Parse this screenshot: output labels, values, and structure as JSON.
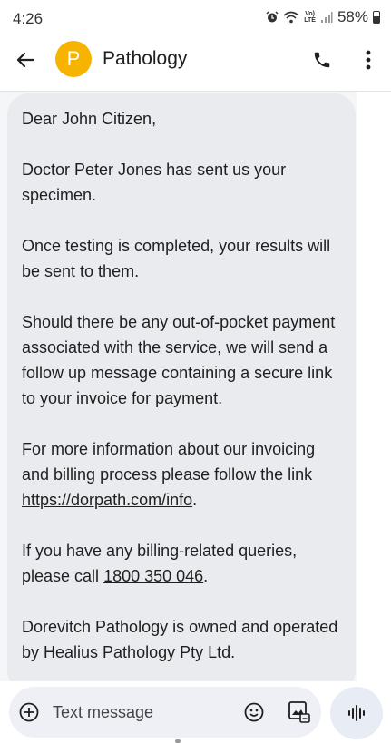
{
  "status_bar": {
    "time": "4:26",
    "volte_line1": "Vo)",
    "volte_line2": "LTE",
    "battery_percent": "58%",
    "icons": [
      "alarm-icon",
      "wifi-icon",
      "volte-icon",
      "signal-icon",
      "battery-icon"
    ]
  },
  "app_bar": {
    "avatar_letter": "P",
    "avatar_color": "#f6b400",
    "contact_name": "Pathology",
    "icons": [
      "back-arrow-icon",
      "phone-icon",
      "more-vert-icon"
    ]
  },
  "message": {
    "greeting": "Dear John Citizen,",
    "p1": "Doctor Peter Jones has sent us your specimen.",
    "p2": "Once testing is completed, your results will be sent to them.",
    "p3": "Should there be any out-of-pocket payment associated with the service, we will send a follow up message containing a secure link to your invoice for payment.",
    "p4_prefix": "For more information about our invoicing and billing process please follow the link ",
    "p4_link": "https://dorpath.com/info",
    "p4_suffix": ".",
    "p5_prefix": "If you have any billing-related queries, please call ",
    "p5_phone": "1800 350 046",
    "p5_suffix": ".",
    "p6": "Dorevitch Pathology is owned and operated by Healius Pathology Pty Ltd."
  },
  "composer": {
    "placeholder": "Text message",
    "icons": [
      "add-icon",
      "emoji-icon",
      "gallery-icon",
      "voice-waveform-icon"
    ]
  }
}
